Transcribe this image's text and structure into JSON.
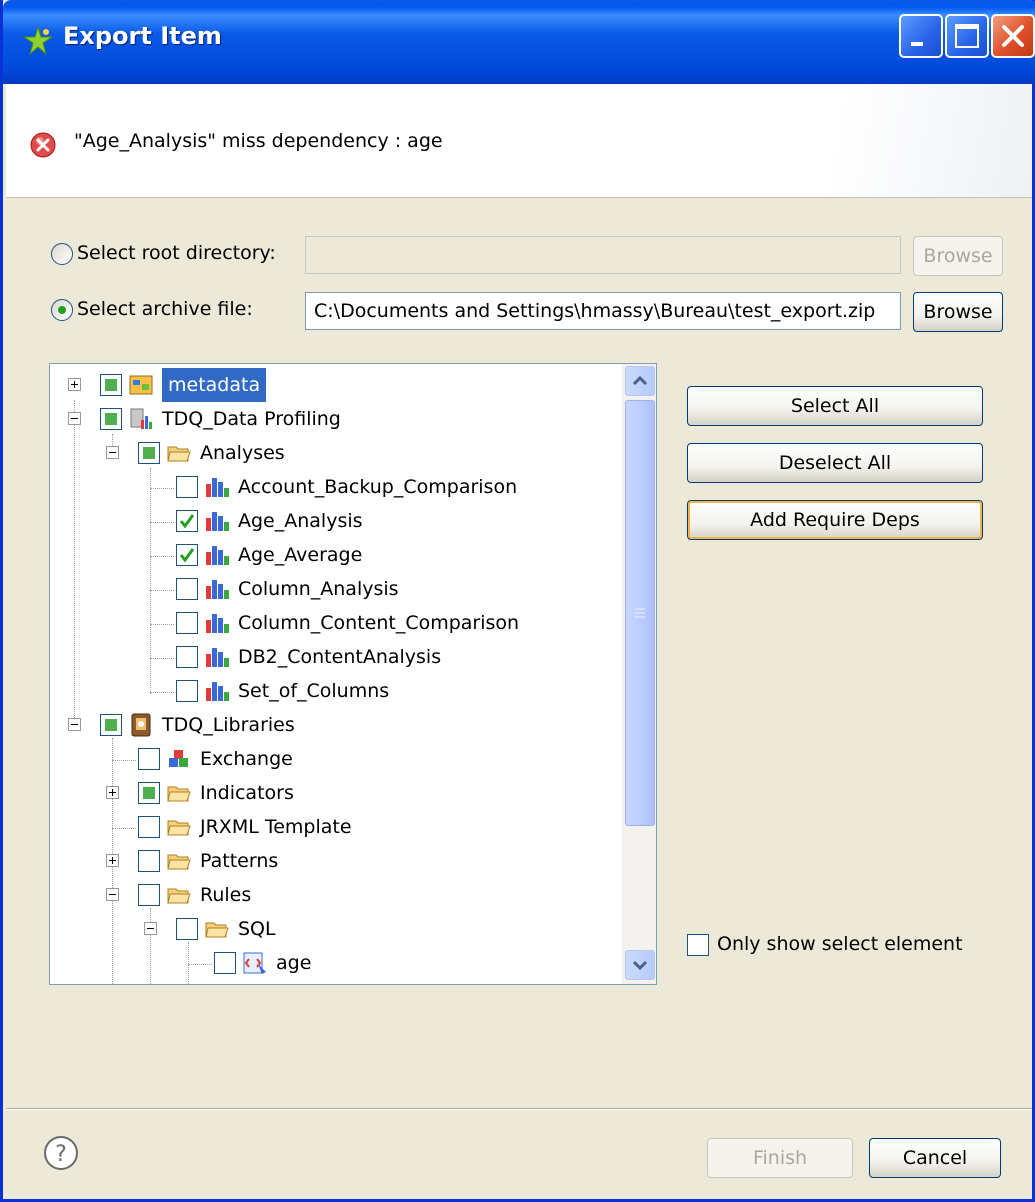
{
  "window": {
    "title": "Export Item",
    "controls": [
      "minimize",
      "maximize",
      "close"
    ]
  },
  "header": {
    "message": "\"Age_Analysis\" miss dependency : age",
    "icon": "error-icon"
  },
  "source": {
    "root_label": "Select root directory:",
    "root_value": "",
    "root_selected": false,
    "archive_label": "Select archive file:",
    "archive_value": "C:\\Documents and Settings\\hmassy\\Bureau\\test_export.zip",
    "archive_selected": true,
    "browse_label": "Browse",
    "browse_root_label": "Browse"
  },
  "tree": {
    "nodes": [
      {
        "label": "metadata",
        "state": "partial",
        "icon": "metadata-icon",
        "selected": true
      },
      {
        "label": "TDQ_Data Profiling",
        "state": "partial",
        "icon": "data-profiling-icon"
      },
      {
        "label": "Analyses",
        "state": "partial",
        "icon": "folder-icon"
      },
      {
        "label": "Account_Backup_Comparison",
        "state": "unchecked",
        "icon": "analysis-chart-icon"
      },
      {
        "label": "Age_Analysis",
        "state": "checked",
        "icon": "analysis-chart-icon"
      },
      {
        "label": "Age_Average",
        "state": "checked",
        "icon": "analysis-chart-icon"
      },
      {
        "label": "Column_Analysis",
        "state": "unchecked",
        "icon": "analysis-chart-icon"
      },
      {
        "label": "Column_Content_Comparison",
        "state": "unchecked",
        "icon": "analysis-chart-icon"
      },
      {
        "label": "DB2_ContentAnalysis",
        "state": "unchecked",
        "icon": "analysis-chart-icon"
      },
      {
        "label": "Set_of_Columns",
        "state": "unchecked",
        "icon": "analysis-chart-icon"
      },
      {
        "label": "TDQ_Libraries",
        "state": "partial",
        "icon": "libraries-icon"
      },
      {
        "label": "Exchange",
        "state": "unchecked",
        "icon": "exchange-icon"
      },
      {
        "label": "Indicators",
        "state": "partial",
        "icon": "folder-icon"
      },
      {
        "label": "JRXML Template",
        "state": "unchecked",
        "icon": "folder-icon"
      },
      {
        "label": "Patterns",
        "state": "unchecked",
        "icon": "folder-icon"
      },
      {
        "label": "Rules",
        "state": "unchecked",
        "icon": "folder-icon"
      },
      {
        "label": "SQL",
        "state": "unchecked",
        "icon": "folder-icon"
      },
      {
        "label": "age",
        "state": "unchecked",
        "icon": "sql-rule-icon"
      }
    ]
  },
  "actions": {
    "select_all": "Select All",
    "deselect_all": "Deselect All",
    "add_require_deps": "Add Require Deps"
  },
  "only_show": {
    "label": "Only show select element",
    "checked": false
  },
  "footer": {
    "finish": "Finish",
    "cancel": "Cancel",
    "help_icon": "help-icon"
  },
  "colors": {
    "title_bar": "#0a5ae8",
    "selection": "#316ac5",
    "check_green": "#21a121"
  }
}
